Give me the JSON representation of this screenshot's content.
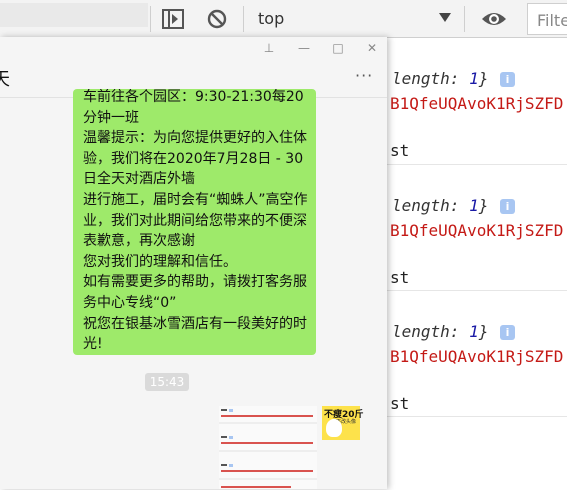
{
  "devtools": {
    "context_label": "top",
    "filter_placeholder": "Filte",
    "entries": [
      {
        "object_key": "length:",
        "object_value": "1",
        "info": "i",
        "string_value": "B1QfeUQAvoK1RjSZFD",
        "type_label": "st"
      },
      {
        "object_key": "length:",
        "object_value": "1",
        "info": "i",
        "string_value": "B1QfeUQAvoK1RjSZFD",
        "type_label": "st"
      },
      {
        "object_key": "length:",
        "object_value": "1",
        "info": "i",
        "string_value": "B1QfeUQAvoK1RjSZFD",
        "type_label": "st"
      }
    ]
  },
  "chat": {
    "window_buttons": {
      "pin": "⊥",
      "minimize": "—",
      "maximize": "□",
      "close": "✕"
    },
    "name": "天",
    "more": "···",
    "message_text": "车前往各个园区：9:30-21:30每20分钟一班\n温馨提示：为向您提供更好的入住体验，我们将在2020年7月28日 - 30日全天对酒店外墙\n进行施工，届时会有“蜘蛛人”高空作业，我们对此期间给您带来的不便深表歉意，再次感谢\n您对我们的理解和信任。\n如有需要更多的帮助，请拨打客务服务中心专线“0”\n祝您在银基冰雪酒店有一段美好的时光!",
    "timestamp": "15:43",
    "sticker_text": "不瘦20斤",
    "sticker_subtext": "不改头像"
  },
  "colors": {
    "bubble": "#9eea6a",
    "console_string": "#c41a16",
    "info_badge": "#a8c6f2"
  }
}
